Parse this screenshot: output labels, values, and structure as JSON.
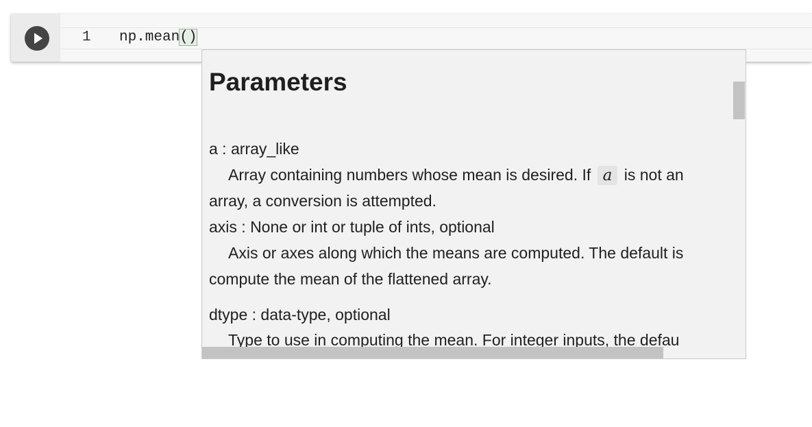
{
  "cell": {
    "run_icon": "play-icon",
    "line_number": "1",
    "code_prefix": "np.mean",
    "code_parens": "()"
  },
  "tooltip": {
    "heading": "Parameters",
    "param_a_sig": "a : array_like",
    "param_a_desc_1": "Array containing numbers whose mean is desired. If",
    "param_a_code": "a",
    "param_a_desc_2": "is not an",
    "param_a_desc_3": "array, a conversion is attempted.",
    "param_axis_sig": "axis : None or int or tuple of ints, optional",
    "param_axis_desc_1": "Axis or axes along which the means are computed. The default is",
    "param_axis_desc_2": "compute the mean of the flattened array.",
    "param_dtype_sig": "dtype : data-type, optional",
    "param_dtype_desc_1": "Type to use in computing the mean.  For integer inputs, the defau"
  },
  "colors": {
    "run_button": "#444444",
    "gutter": "#ebebeb",
    "tooltip_bg": "#f2f2f2",
    "scrollbar": "#c3c3c3"
  }
}
